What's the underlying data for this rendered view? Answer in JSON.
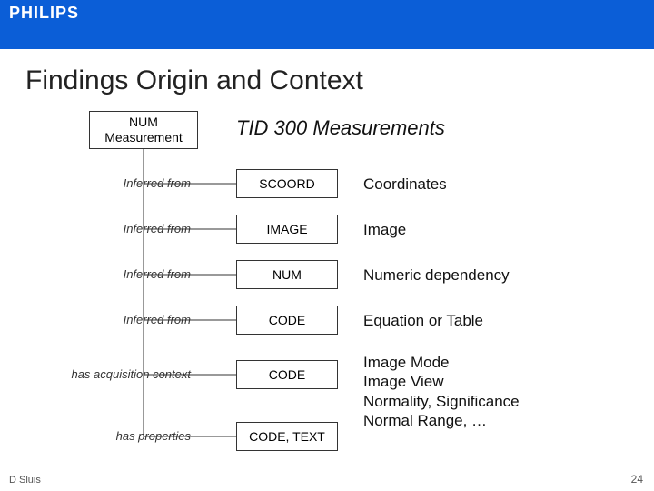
{
  "brand": "PHILIPS",
  "title": "Findings Origin and Context",
  "root": {
    "line1": "NUM",
    "line2": "Measurement"
  },
  "tid_title": "TID 300 Measurements",
  "rows": [
    {
      "label": "Inferred from",
      "code": "SCOORD",
      "desc": "Coordinates"
    },
    {
      "label": "Inferred from",
      "code": "IMAGE",
      "desc": "Image"
    },
    {
      "label": "Inferred from",
      "code": "NUM",
      "desc": "Numeric dependency"
    },
    {
      "label": "Inferred from",
      "code": "CODE",
      "desc": "Equation or Table"
    },
    {
      "label": "has acquisition context",
      "code": "CODE",
      "desc": "Image Mode\nImage View\nNormality, Significance\nNormal Range, …"
    },
    {
      "label": "has properties",
      "code": "CODE, TEXT",
      "desc": ""
    }
  ],
  "footer": "D Sluis",
  "page_number": "24"
}
